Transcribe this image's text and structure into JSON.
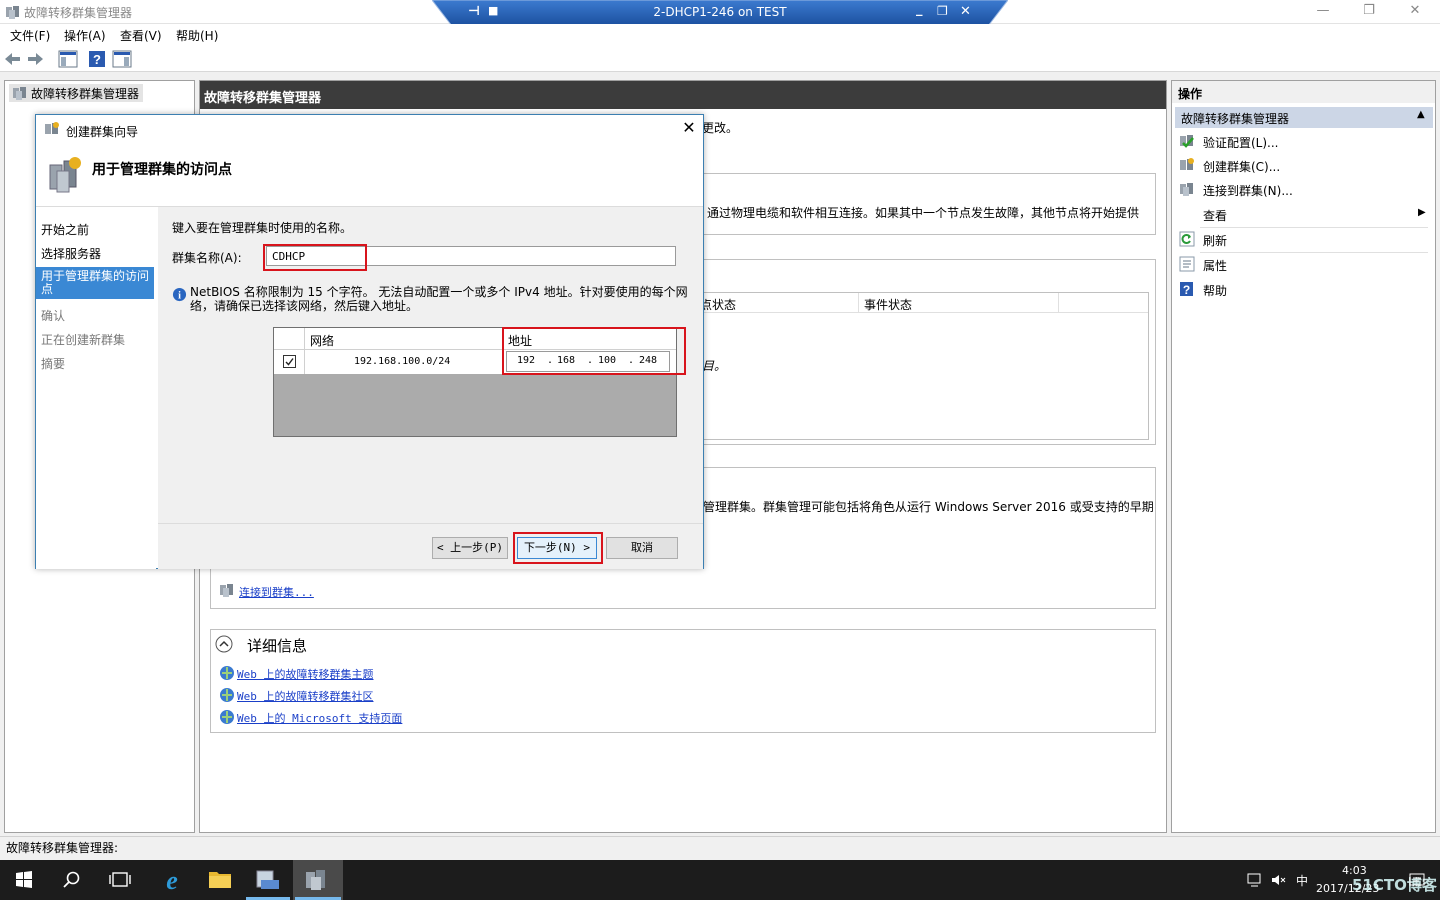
{
  "window": {
    "title": "故障转移群集管理器",
    "minimize": "—",
    "restore": "❐",
    "close": "✕"
  },
  "rdp": {
    "title": "2-DHCP1-246 on TEST",
    "pin": "⊞",
    "lock": "🔒",
    "min": "_",
    "restore": "❐",
    "close": "✕"
  },
  "menu": {
    "file": "文件(F)",
    "action": "操作(A)",
    "view": "查看(V)",
    "help": "帮助(H)"
  },
  "tree": {
    "root": "故障转移群集管理器"
  },
  "main": {
    "header": "故障转移群集管理器",
    "frag_change": "更改。",
    "frag_cable": "通过物理电缆和软件相互连接。如果其中一个节点发生故障，其他节点将开始提供",
    "col_node_status": "点状态",
    "col_event_status": "事件状态",
    "frag_item": "目。",
    "frag_manage": "管理群集。群集管理可能包括将角色从运行 Windows Server 2016 或受支持的早期",
    "link_connect": "连接到群集...",
    "details_title": "详细信息",
    "details_links": [
      "Web 上的故障转移群集主题",
      "Web 上的故障转移群集社区",
      "Web 上的 Microsoft 支持页面"
    ]
  },
  "actions": {
    "header": "操作",
    "section": "故障转移群集管理器",
    "items": [
      "验证配置(L)...",
      "创建群集(C)...",
      "连接到群集(N)...",
      "查看",
      "刷新",
      "属性",
      "帮助"
    ]
  },
  "status": {
    "text": "故障转移群集管理器:"
  },
  "wizard": {
    "title": "创建群集向导",
    "heading": "用于管理群集的访问点",
    "steps": [
      "开始之前",
      "选择服务器",
      "用于管理群集的访问点",
      "确认",
      "正在创建新群集",
      "摘要"
    ],
    "instruction": "键入要在管理群集时使用的名称。",
    "name_label": "群集名称(A):",
    "name_value": "CDHCP",
    "info_line1": "NetBIOS 名称限制为 15 个字符。 无法自动配置一个或多个 IPv4 地址。针对要使用的每个网",
    "info_line2": "络，请确保已选择该网络，然后键入地址。",
    "grid_col_network": "网络",
    "grid_col_address": "地址",
    "network": "192.168.100.0/24",
    "ip": [
      "192",
      "168",
      "100",
      "248"
    ],
    "btn_prev": "< 上一步(P)",
    "btn_next": "下一步(N) >",
    "btn_cancel": "取消"
  },
  "taskbar": {
    "time": "4:03",
    "date": "2017/12/23",
    "ime": "中",
    "watermark": "51CTO博客"
  }
}
